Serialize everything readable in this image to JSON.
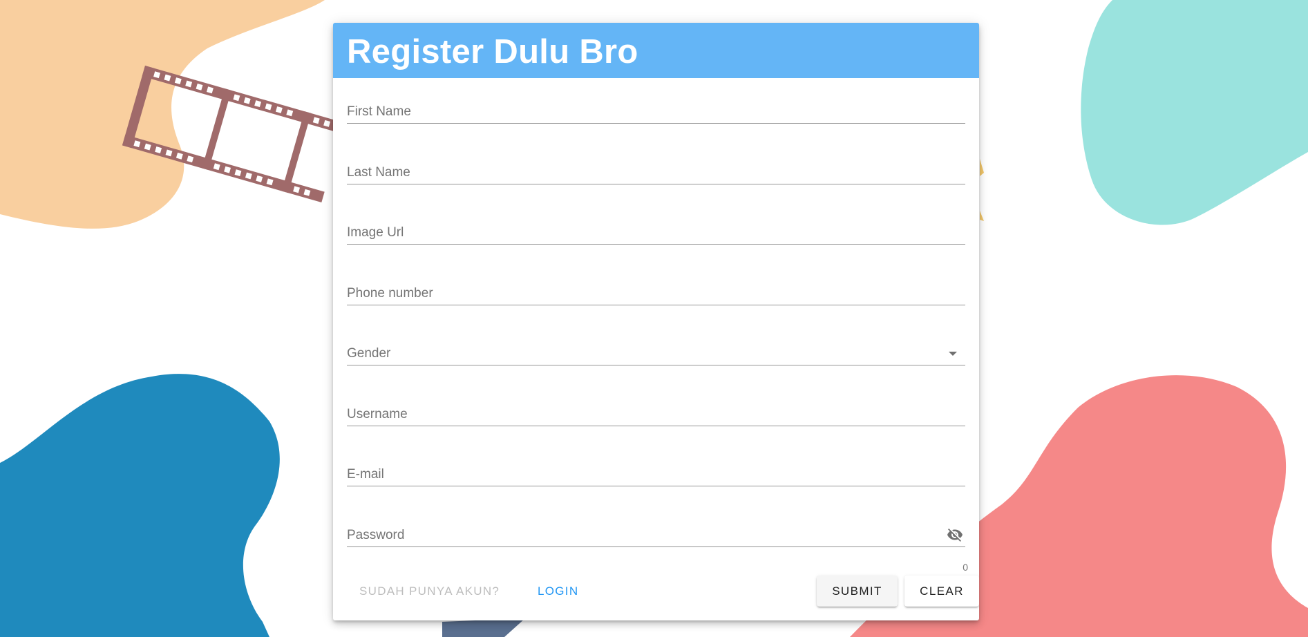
{
  "colors": {
    "header": "#64b5f6",
    "login_link": "#2196f3",
    "blob_orange": "#f9cf9f",
    "blob_teal": "#9ae3de",
    "blob_blue": "#1f8abd",
    "blob_red": "#f58888",
    "film_strip": "#a06a6a"
  },
  "card": {
    "title": "Register Dulu Bro"
  },
  "form": {
    "first_name": {
      "label": "First Name"
    },
    "last_name": {
      "label": "Last Name"
    },
    "image_url": {
      "label": "Image Url"
    },
    "phone": {
      "label": "Phone number"
    },
    "gender": {
      "label": "Gender",
      "icon": "chevron-down-icon"
    },
    "username": {
      "label": "Username"
    },
    "email": {
      "label": "E-mail"
    },
    "password": {
      "label": "Password",
      "icon": "eye-off-icon",
      "counter": "0"
    }
  },
  "actions": {
    "have_account": "SUDAH PUNYA AKUN?",
    "login": "LOGIN",
    "submit": "SUBMIT",
    "clear": "CLEAR"
  }
}
